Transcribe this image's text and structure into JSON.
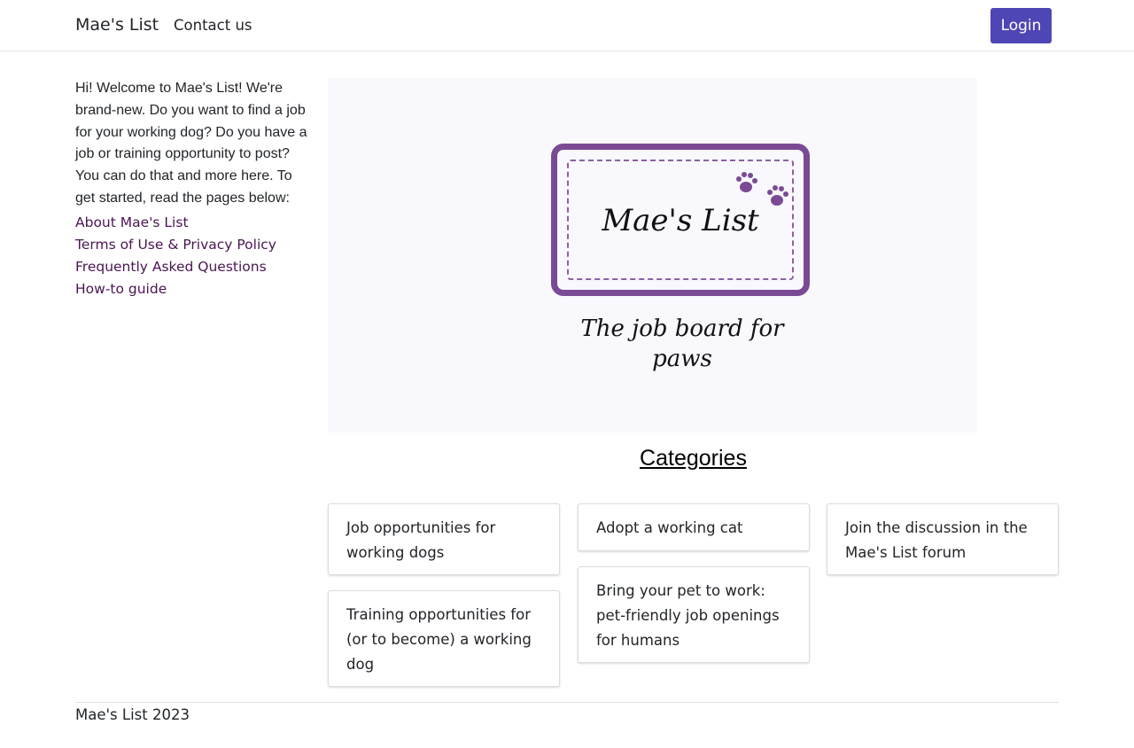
{
  "nav": {
    "brand": "Mae's List",
    "contact": "Contact us",
    "login": "Login"
  },
  "sidebar": {
    "intro": "Hi! Welcome to Mae's List! We're brand-new. Do you want to find a job for your working dog? Do you have a job or training opportunity to post? You can do that and more here. To get started, read the pages below:",
    "links": [
      "About Mae's List",
      "Terms of Use & Privacy Policy",
      "Frequently Asked Questions",
      "How-to guide"
    ]
  },
  "hero": {
    "logo_text": "Mae's List",
    "tagline": "The job board for paws"
  },
  "categories": {
    "title": "Categories",
    "items": [
      "Job opportunities for working dogs",
      "Training opportunities for (or to become) a working dog",
      "Adopt a working cat",
      "Bring your pet to work: pet-friendly job openings for humans",
      "Join the discussion in the Mae's List forum"
    ]
  },
  "footer": {
    "text": "Mae's List 2023"
  },
  "colors": {
    "accent": "#4f46b5",
    "logo_purple": "#7a4a94",
    "link": "#4a1552"
  }
}
